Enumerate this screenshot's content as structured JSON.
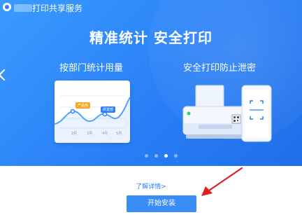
{
  "header": {
    "title": "打印共享服务"
  },
  "banner": {
    "headline": "精准统计  安全打印",
    "feature_left": "按部门统计用量",
    "feature_right": "安全打印防止泄密",
    "chart": {
      "tag_orange": "产品部",
      "tag_blue": "研发部",
      "x_labels": [
        "2月",
        "3月",
        "4月",
        "5月"
      ]
    },
    "carousel": {
      "count": 4,
      "active_index": 2
    }
  },
  "footer": {
    "more_link": "了解详情>",
    "install_button": "开始安装"
  },
  "colors": {
    "brand_blue": "#2a7ff6",
    "annotation_red": "#e02020",
    "tag_orange": "#f5a623"
  },
  "icons": [
    "logo-icon",
    "left-arrow-icon",
    "printer-icon",
    "qr-code-icon",
    "phone-icon"
  ]
}
